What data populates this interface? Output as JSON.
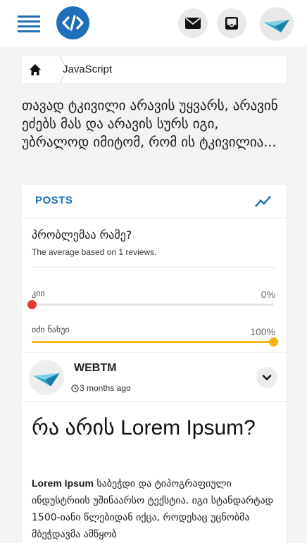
{
  "header": {
    "menu_icon": "hamburger-menu-icon",
    "logo_icon": "code-brackets-icon",
    "mail_icon": "envelope-icon",
    "inbox_icon": "inbox-tray-icon",
    "avatar_icon": "paper-plane-logo-icon",
    "brand_color": "#1e6fb8"
  },
  "breadcrumb": {
    "home_icon": "home-icon",
    "current": "JavaScript"
  },
  "quote": "თავად ტკივილი არავის უყვარს, არავინ ეძებს მას და არავის სურს იგი, უბრალოდ იმიტომ, რომ ის ტკივილია...",
  "posts_card": {
    "tab_label": "POSTS",
    "trend_icon": "trending-up-icon",
    "poll": {
      "question": "პრობლემაა რამე?",
      "average_text": "The average based on 1 reviews.",
      "options": [
        {
          "label": "კიი",
          "percent_text": "0%",
          "percent": 0,
          "color": "#e53935"
        },
        {
          "label": "იძი ნახუი",
          "percent_text": "100%",
          "percent": 100,
          "color": "#f2b418"
        }
      ]
    }
  },
  "post": {
    "author": "WEBTM",
    "time": "3 months ago",
    "clock_icon": "clock-icon",
    "chevron_icon": "chevron-down-icon",
    "title": "რა არის Lorem Ipsum?",
    "body_bold": "Lorem Ipsum",
    "body_text": " საბეჭდი და ტიპოგრაფიული ინდუსტრიის უშინაარსო ტექსტია. იგი სტანდარტად 1500-იანი წლებიდან იქცა, როდესაც უცნობმა მბეჭდავმა ამწყობ"
  }
}
